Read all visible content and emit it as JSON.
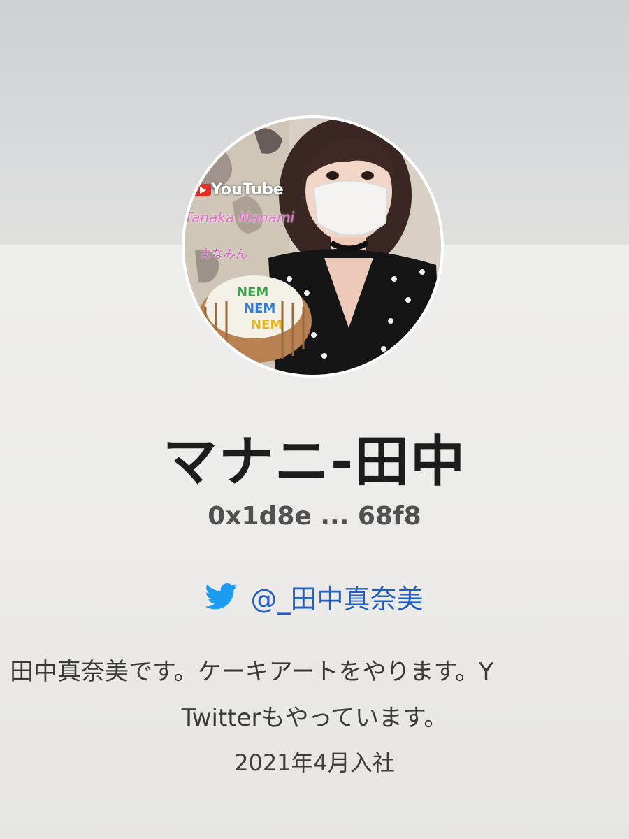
{
  "profile": {
    "display_name": "マナニ-田中",
    "wallet_address": "0x1d8e ... 68f8",
    "twitter_handle": "@_田中真奈美",
    "bio_line1": "。田中真奈美です。ケーキアートをやります。Y",
    "bio_line2": "Twitterもやっています。",
    "joined": "2021年4月入社"
  },
  "avatar": {
    "overlay_youtube": "YouTube",
    "overlay_name": "Tanaka Manami",
    "overlay_sub": "まなみん",
    "cake_text": [
      "NEM",
      "NEM",
      "NEM"
    ]
  },
  "colors": {
    "twitter": "#1d9bf0",
    "handle": "#1f5fc2",
    "name_text": "#1c1c1c"
  }
}
